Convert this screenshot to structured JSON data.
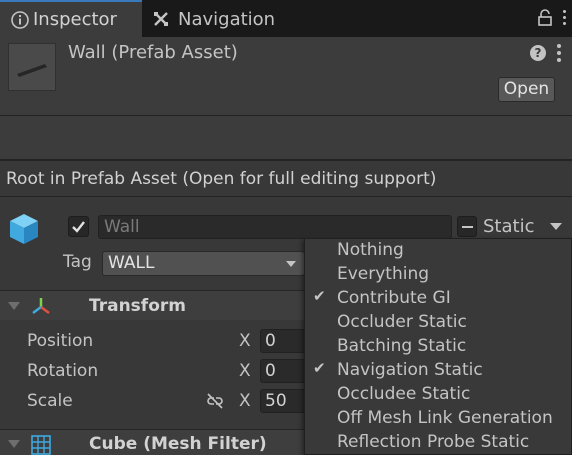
{
  "tabs": [
    {
      "label": "Inspector",
      "active": true
    },
    {
      "label": "Navigation",
      "active": false
    }
  ],
  "header": {
    "title": "Wall (Prefab Asset)",
    "open_label": "Open"
  },
  "root_notice": "Root in Prefab Asset (Open for full editing support)",
  "gameobject": {
    "active": true,
    "name": "Wall",
    "static_label": "Static",
    "static_state": "mixed",
    "tag_label": "Tag",
    "tag_value": "WALL"
  },
  "transform": {
    "title": "Transform",
    "rows": [
      {
        "label": "Position",
        "axis": "X",
        "value": "0"
      },
      {
        "label": "Rotation",
        "axis": "X",
        "value": "0"
      },
      {
        "label": "Scale",
        "axis": "X",
        "value": "50"
      }
    ]
  },
  "mesh_filter": {
    "title": "Cube (Mesh Filter)"
  },
  "static_menu": {
    "items": [
      {
        "label": "Nothing",
        "checked": false
      },
      {
        "label": "Everything",
        "checked": false
      },
      {
        "label": "Contribute GI",
        "checked": true
      },
      {
        "label": "Occluder Static",
        "checked": false
      },
      {
        "label": "Batching Static",
        "checked": false
      },
      {
        "label": "Navigation Static",
        "checked": true
      },
      {
        "label": "Occludee Static",
        "checked": false
      },
      {
        "label": "Off Mesh Link Generation",
        "checked": false
      },
      {
        "label": "Reflection Probe Static",
        "checked": false
      }
    ]
  },
  "colors": {
    "accent": "#3a79bb",
    "cube_icon": "#3fa9e0"
  },
  "icons": [
    "info-icon",
    "navigation-icon",
    "lock-icon",
    "menu-icon",
    "help-icon",
    "cube-icon",
    "transform-icon",
    "constrain-proportions-icon",
    "mesh-filter-icon",
    "checkmark-icon"
  ]
}
